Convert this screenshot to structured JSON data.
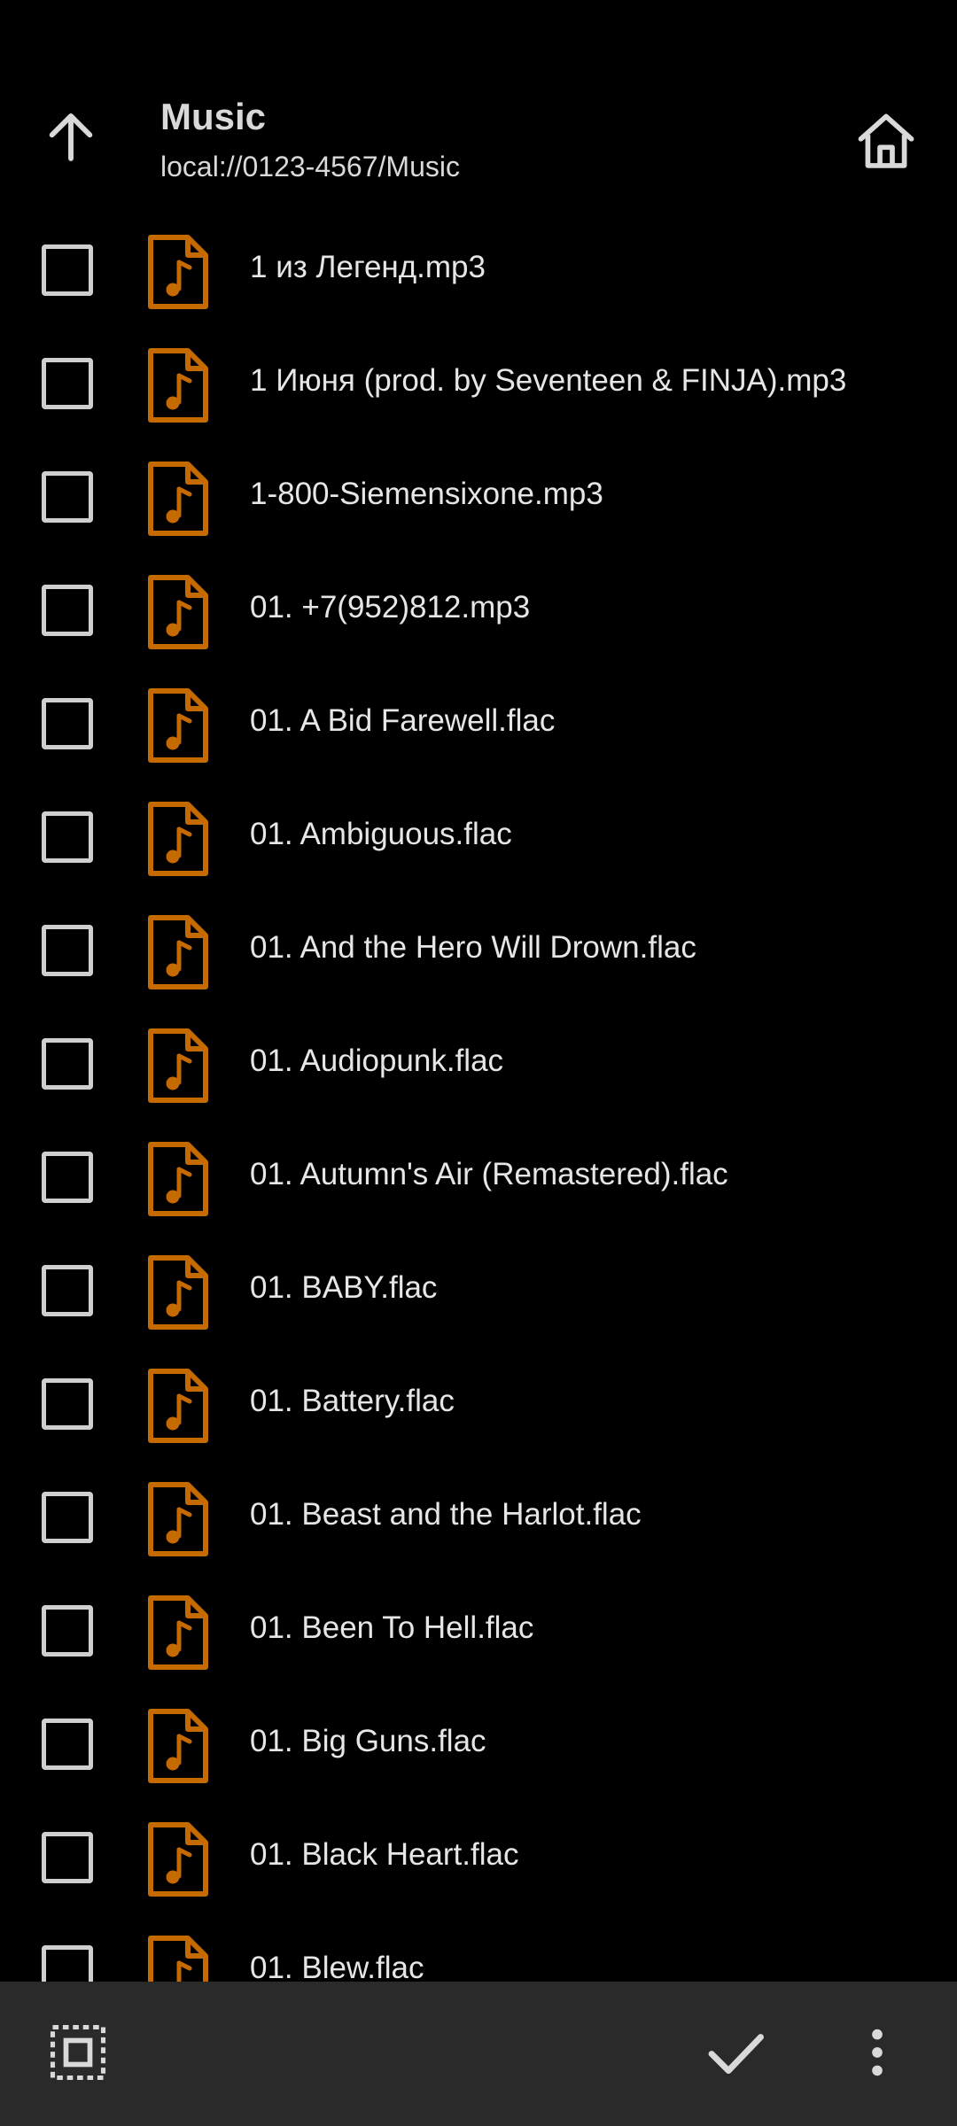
{
  "header": {
    "title": "Music",
    "path": "local://0123-4567/Music",
    "up_icon": "arrow-up-icon",
    "home_icon": "home-icon"
  },
  "colors": {
    "background": "#000000",
    "text": "#e6e6e6",
    "file_icon": "#c46a00",
    "bottom_bar": "#2a2a2a"
  },
  "files": [
    {
      "name": "1 из Легенд.mp3",
      "checked": false
    },
    {
      "name": "1 Июня (prod. by Seventeen & FINJA).mp3",
      "checked": false
    },
    {
      "name": "1-800-Siemensixone.mp3",
      "checked": false
    },
    {
      "name": "01. +7(952)812.mp3",
      "checked": false
    },
    {
      "name": "01. A Bid Farewell.flac",
      "checked": false
    },
    {
      "name": "01. Ambiguous.flac",
      "checked": false
    },
    {
      "name": "01. And the Hero Will Drown.flac",
      "checked": false
    },
    {
      "name": "01. Audiopunk.flac",
      "checked": false
    },
    {
      "name": "01. Autumn's Air (Remastered).flac",
      "checked": false
    },
    {
      "name": "01. BABY.flac",
      "checked": false
    },
    {
      "name": "01. Battery.flac",
      "checked": false
    },
    {
      "name": "01. Beast and the Harlot.flac",
      "checked": false
    },
    {
      "name": "01. Been To Hell.flac",
      "checked": false
    },
    {
      "name": "01. Big Guns.flac",
      "checked": false
    },
    {
      "name": "01. Black Heart.flac",
      "checked": false
    },
    {
      "name": "01. Blew.flac",
      "checked": false
    }
  ],
  "bottom_bar": {
    "select_all_icon": "select-all-icon",
    "confirm_icon": "check-icon",
    "more_icon": "more-vert-icon"
  }
}
